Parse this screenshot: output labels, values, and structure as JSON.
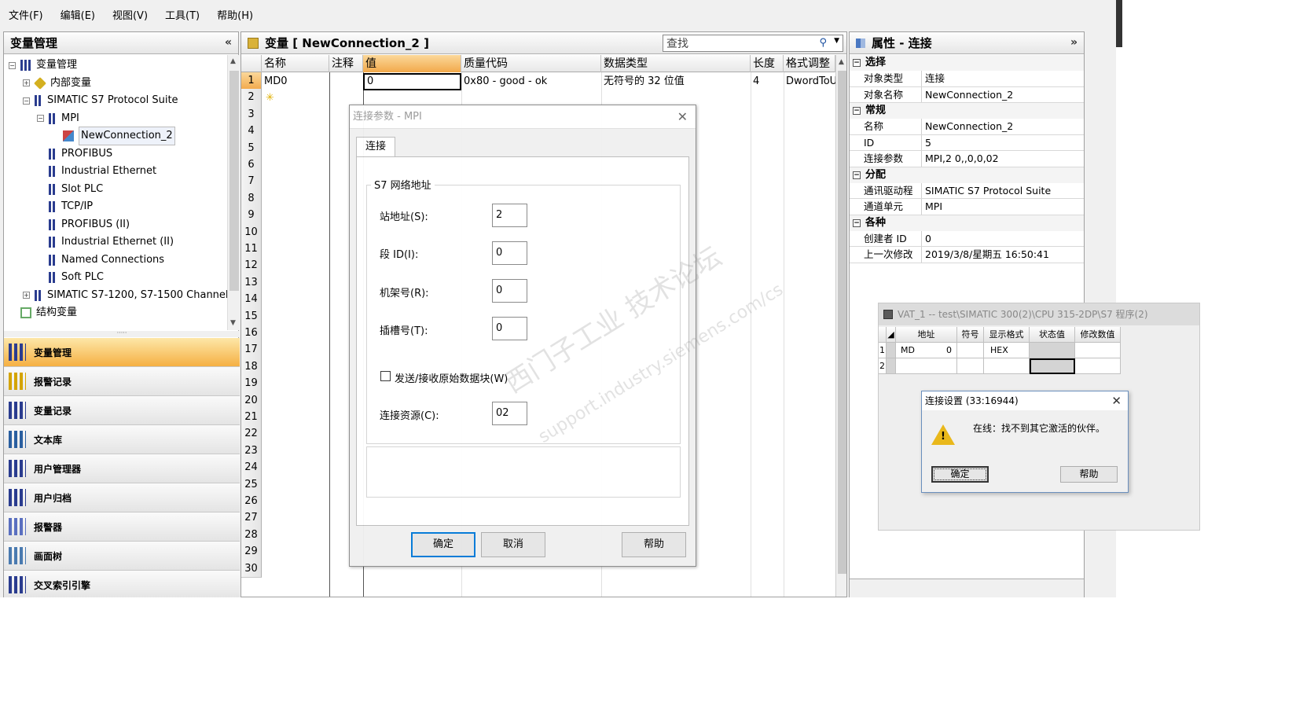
{
  "menu": [
    "文件(F)",
    "编辑(E)",
    "视图(V)",
    "工具(T)",
    "帮助(H)"
  ],
  "left": {
    "title": "变量管理",
    "tree": [
      {
        "label": "变量管理",
        "indent": 0,
        "toggle": "⊟",
        "icon": "bars"
      },
      {
        "label": "内部变量",
        "indent": 1,
        "toggle": "⊞",
        "icon": "cube"
      },
      {
        "label": "SIMATIC S7 Protocol Suite",
        "indent": 1,
        "toggle": "⊟",
        "icon": "bars-sm"
      },
      {
        "label": "MPI",
        "indent": 2,
        "toggle": "⊟",
        "icon": "bars-sm"
      },
      {
        "label": "NewConnection_2",
        "indent": 3,
        "toggle": "",
        "icon": "conn"
      },
      {
        "label": "PROFIBUS",
        "indent": 2,
        "toggle": "",
        "icon": "bars-sm"
      },
      {
        "label": "Industrial Ethernet",
        "indent": 2,
        "toggle": "",
        "icon": "bars-sm"
      },
      {
        "label": "Slot PLC",
        "indent": 2,
        "toggle": "",
        "icon": "bars-sm"
      },
      {
        "label": "TCP/IP",
        "indent": 2,
        "toggle": "",
        "icon": "bars-sm"
      },
      {
        "label": "PROFIBUS (II)",
        "indent": 2,
        "toggle": "",
        "icon": "bars-sm"
      },
      {
        "label": "Industrial Ethernet (II)",
        "indent": 2,
        "toggle": "",
        "icon": "bars-sm"
      },
      {
        "label": "Named Connections",
        "indent": 2,
        "toggle": "",
        "icon": "bars-sm"
      },
      {
        "label": "Soft PLC",
        "indent": 2,
        "toggle": "",
        "icon": "bars-sm"
      },
      {
        "label": "SIMATIC S7-1200, S7-1500 Channel",
        "indent": 1,
        "toggle": "⊞",
        "icon": "bars-sm"
      },
      {
        "label": "结构变量",
        "indent": 0,
        "toggle": "",
        "icon": "struct"
      }
    ],
    "nav": [
      "变量管理",
      "报警记录",
      "变量记录",
      "文本库",
      "用户管理器",
      "用户归档",
      "报警器",
      "画面树",
      "交叉索引引擎"
    ],
    "nav_active": 0,
    "nav_colors": [
      "#2a3c8f",
      "#d4a400",
      "#2a3c8f",
      "#2a5fa0",
      "#2a3c8f",
      "#2a3c8f",
      "#5a6fc0",
      "#4a7ab0",
      "#2a3c8f"
    ]
  },
  "center": {
    "title": "变量 [ NewConnection_2 ]",
    "search_placeholder": "查找",
    "columns": [
      "名称",
      "注释",
      "值",
      "质量代码",
      "数据类型",
      "长度",
      "格式调整"
    ],
    "selected_column": 2,
    "row1": {
      "name": "MD0",
      "comment": "",
      "value": "0",
      "quality": "0x80 - good - ok",
      "type": "无符号的 32 位值",
      "length": "4",
      "format": "DwordToUnsign"
    },
    "row2_marker": "✳",
    "row_count": 30
  },
  "props": {
    "title": "属性 - 连接",
    "groups": [
      {
        "name": "选择",
        "rows": [
          [
            "对象类型",
            "连接"
          ],
          [
            "对象名称",
            "NewConnection_2"
          ]
        ]
      },
      {
        "name": "常规",
        "rows": [
          [
            "名称",
            "NewConnection_2"
          ],
          [
            "ID",
            "5"
          ],
          [
            "连接参数",
            "MPI,2 0,,0,0,02"
          ]
        ]
      },
      {
        "name": "分配",
        "rows": [
          [
            "通讯驱动程序",
            "SIMATIC S7 Protocol Suite"
          ],
          [
            "通道单元",
            "MPI"
          ]
        ]
      },
      {
        "name": "各种",
        "rows": [
          [
            "创建者 ID",
            "0"
          ],
          [
            "上一次修改",
            "2019/3/8/星期五 16:50:41"
          ]
        ]
      }
    ]
  },
  "dialog": {
    "title": "连接参数 - MPI",
    "tab": "连接",
    "group": "S7 网络地址",
    "fields": [
      {
        "label": "站地址(S):",
        "value": "2"
      },
      {
        "label": "段 ID(I):",
        "value": "0"
      },
      {
        "label": "机架号(R):",
        "value": "0"
      },
      {
        "label": "插槽号(T):",
        "value": "0"
      }
    ],
    "checkbox": "发送/接收原始数据块(W)",
    "resource_label": "连接资源(C):",
    "resource_value": "02",
    "ok": "确定",
    "cancel": "取消",
    "help": "帮助"
  },
  "vat": {
    "title": "VAT_1 -- test\\SIMATIC 300(2)\\CPU 315-2DP\\S7 程序(2)",
    "headers": [
      "地址",
      "符号",
      "显示格式",
      "状态值",
      "修改数值"
    ],
    "row1": {
      "num": "1",
      "addr": "MD",
      "addr_num": "0",
      "format": "HEX"
    },
    "row2": {
      "num": "2"
    }
  },
  "alert": {
    "title": "连接设置 (33:16944)",
    "message": "在线：找不到其它激活的伙伴。",
    "ok": "确定",
    "help": "帮助"
  },
  "watermark": {
    "cn": "西门子工业 技术论坛",
    "en": "support.industry.siemens.com/cs"
  }
}
